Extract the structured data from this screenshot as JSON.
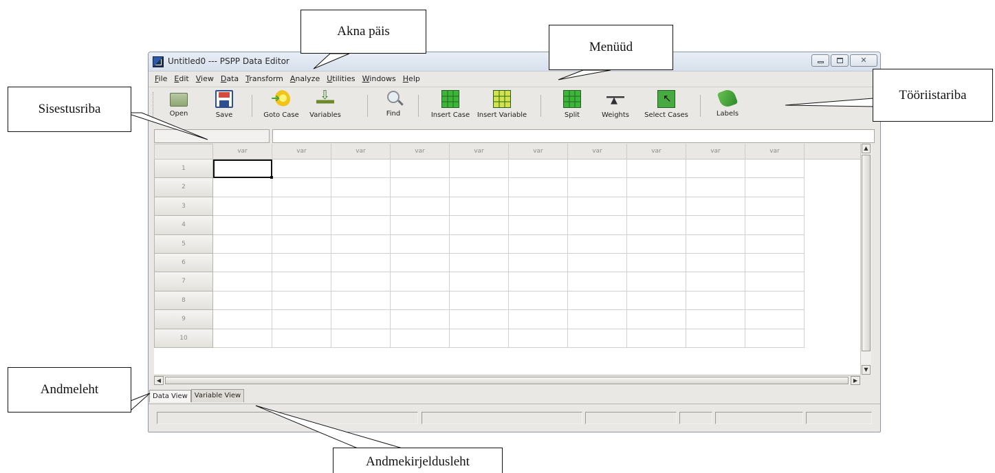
{
  "window": {
    "title": "Untitled0 --- PSPP Data Editor",
    "controls": {
      "minimize": "",
      "maximize": "",
      "close": "✕"
    }
  },
  "menubar": [
    {
      "mnemonic": "F",
      "rest": "ile"
    },
    {
      "mnemonic": "E",
      "rest": "dit"
    },
    {
      "mnemonic": "V",
      "rest": "iew"
    },
    {
      "mnemonic": "D",
      "rest": "ata"
    },
    {
      "mnemonic": "T",
      "rest": "ransform"
    },
    {
      "mnemonic": "A",
      "rest": "nalyze"
    },
    {
      "mnemonic": "U",
      "rest": "tilities"
    },
    {
      "mnemonic": "W",
      "rest": "indows"
    },
    {
      "mnemonic": "H",
      "rest": "elp"
    }
  ],
  "toolbar": {
    "open": "Open",
    "save": "Save",
    "goto_case": "Goto Case",
    "variables": "Variables",
    "find": "Find",
    "insert_case": "Insert Case",
    "insert_variable": "Insert Variable",
    "split": "Split",
    "weights": "Weights",
    "select_cases": "Select Cases",
    "labels": "Labels"
  },
  "entry_bar": {
    "name": "",
    "value": ""
  },
  "grid": {
    "column_headers": [
      "var",
      "var",
      "var",
      "var",
      "var",
      "var",
      "var",
      "var",
      "var",
      "var"
    ],
    "row_headers": [
      "1",
      "2",
      "3",
      "4",
      "5",
      "6",
      "7",
      "8",
      "9",
      "10"
    ],
    "active_cell": {
      "row": 1,
      "column": 1
    }
  },
  "tabs": {
    "data_view": "Data View",
    "variable_view": "Variable View",
    "active": "Data View"
  },
  "annotations": {
    "akna_pais": "Akna päis",
    "menuud": "Menüüd",
    "sisestusriba": "Sisestusriba",
    "tooriistariba": "Tööriistariba",
    "andmeleht": "Andmeleht",
    "andmekirjeldusleht": "Andmekirjeldusleht"
  }
}
